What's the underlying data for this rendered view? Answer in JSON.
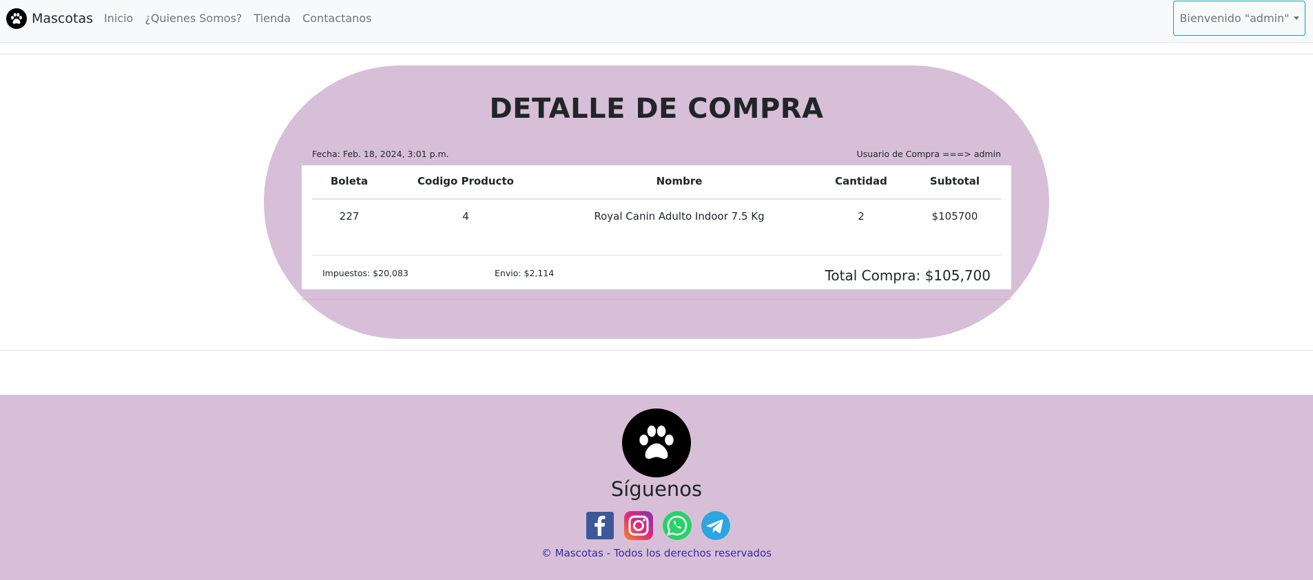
{
  "navbar": {
    "brand": "Mascotas",
    "links": [
      "Inicio",
      "¿Quienes Somos?",
      "Tienda",
      "Contactanos"
    ],
    "user_menu": "Bienvenido \"admin\""
  },
  "purchase": {
    "title": "DETALLE DE COMPRA",
    "date": "Fecha: Feb. 18, 2024, 3:01 p.m.",
    "user": "Usuario de Compra ===> admin",
    "columns": [
      "Boleta",
      "Codigo Producto",
      "Nombre",
      "Cantidad",
      "Subtotal"
    ],
    "rows": [
      [
        "227",
        "4",
        "Royal Canin Adulto Indoor 7.5 Kg",
        "2",
        "$105700"
      ]
    ],
    "taxes": "Impuestos: $20,083",
    "shipping": "Envio: $2,114",
    "total": "Total Compra: $105,700"
  },
  "footer": {
    "follow": "Síguenos",
    "socials": [
      "facebook-icon",
      "instagram-icon",
      "whatsapp-icon",
      "telegram-icon"
    ],
    "copyright": "© Mascotas - Todos los derechos reservados"
  },
  "colors": {
    "accent_lilac": "#d8bfd8",
    "outline_button": "#17a2b8",
    "copyright_text": "#3a2a9a"
  }
}
